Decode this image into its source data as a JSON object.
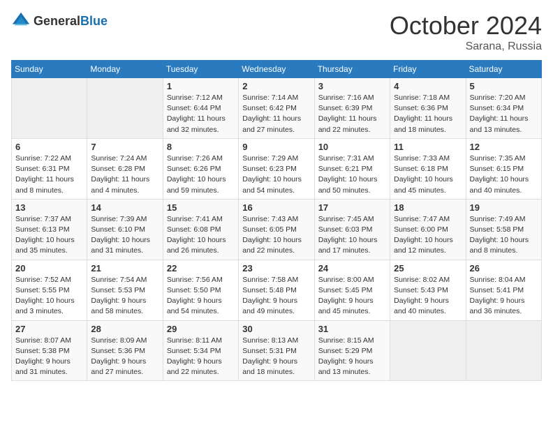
{
  "header": {
    "logo_general": "General",
    "logo_blue": "Blue",
    "month": "October 2024",
    "location": "Sarana, Russia"
  },
  "days_of_week": [
    "Sunday",
    "Monday",
    "Tuesday",
    "Wednesday",
    "Thursday",
    "Friday",
    "Saturday"
  ],
  "weeks": [
    [
      null,
      null,
      {
        "day": "1",
        "sunrise": "Sunrise: 7:12 AM",
        "sunset": "Sunset: 6:44 PM",
        "daylight": "Daylight: 11 hours and 32 minutes."
      },
      {
        "day": "2",
        "sunrise": "Sunrise: 7:14 AM",
        "sunset": "Sunset: 6:42 PM",
        "daylight": "Daylight: 11 hours and 27 minutes."
      },
      {
        "day": "3",
        "sunrise": "Sunrise: 7:16 AM",
        "sunset": "Sunset: 6:39 PM",
        "daylight": "Daylight: 11 hours and 22 minutes."
      },
      {
        "day": "4",
        "sunrise": "Sunrise: 7:18 AM",
        "sunset": "Sunset: 6:36 PM",
        "daylight": "Daylight: 11 hours and 18 minutes."
      },
      {
        "day": "5",
        "sunrise": "Sunrise: 7:20 AM",
        "sunset": "Sunset: 6:34 PM",
        "daylight": "Daylight: 11 hours and 13 minutes."
      }
    ],
    [
      {
        "day": "6",
        "sunrise": "Sunrise: 7:22 AM",
        "sunset": "Sunset: 6:31 PM",
        "daylight": "Daylight: 11 hours and 8 minutes."
      },
      {
        "day": "7",
        "sunrise": "Sunrise: 7:24 AM",
        "sunset": "Sunset: 6:28 PM",
        "daylight": "Daylight: 11 hours and 4 minutes."
      },
      {
        "day": "8",
        "sunrise": "Sunrise: 7:26 AM",
        "sunset": "Sunset: 6:26 PM",
        "daylight": "Daylight: 10 hours and 59 minutes."
      },
      {
        "day": "9",
        "sunrise": "Sunrise: 7:29 AM",
        "sunset": "Sunset: 6:23 PM",
        "daylight": "Daylight: 10 hours and 54 minutes."
      },
      {
        "day": "10",
        "sunrise": "Sunrise: 7:31 AM",
        "sunset": "Sunset: 6:21 PM",
        "daylight": "Daylight: 10 hours and 50 minutes."
      },
      {
        "day": "11",
        "sunrise": "Sunrise: 7:33 AM",
        "sunset": "Sunset: 6:18 PM",
        "daylight": "Daylight: 10 hours and 45 minutes."
      },
      {
        "day": "12",
        "sunrise": "Sunrise: 7:35 AM",
        "sunset": "Sunset: 6:15 PM",
        "daylight": "Daylight: 10 hours and 40 minutes."
      }
    ],
    [
      {
        "day": "13",
        "sunrise": "Sunrise: 7:37 AM",
        "sunset": "Sunset: 6:13 PM",
        "daylight": "Daylight: 10 hours and 35 minutes."
      },
      {
        "day": "14",
        "sunrise": "Sunrise: 7:39 AM",
        "sunset": "Sunset: 6:10 PM",
        "daylight": "Daylight: 10 hours and 31 minutes."
      },
      {
        "day": "15",
        "sunrise": "Sunrise: 7:41 AM",
        "sunset": "Sunset: 6:08 PM",
        "daylight": "Daylight: 10 hours and 26 minutes."
      },
      {
        "day": "16",
        "sunrise": "Sunrise: 7:43 AM",
        "sunset": "Sunset: 6:05 PM",
        "daylight": "Daylight: 10 hours and 22 minutes."
      },
      {
        "day": "17",
        "sunrise": "Sunrise: 7:45 AM",
        "sunset": "Sunset: 6:03 PM",
        "daylight": "Daylight: 10 hours and 17 minutes."
      },
      {
        "day": "18",
        "sunrise": "Sunrise: 7:47 AM",
        "sunset": "Sunset: 6:00 PM",
        "daylight": "Daylight: 10 hours and 12 minutes."
      },
      {
        "day": "19",
        "sunrise": "Sunrise: 7:49 AM",
        "sunset": "Sunset: 5:58 PM",
        "daylight": "Daylight: 10 hours and 8 minutes."
      }
    ],
    [
      {
        "day": "20",
        "sunrise": "Sunrise: 7:52 AM",
        "sunset": "Sunset: 5:55 PM",
        "daylight": "Daylight: 10 hours and 3 minutes."
      },
      {
        "day": "21",
        "sunrise": "Sunrise: 7:54 AM",
        "sunset": "Sunset: 5:53 PM",
        "daylight": "Daylight: 9 hours and 58 minutes."
      },
      {
        "day": "22",
        "sunrise": "Sunrise: 7:56 AM",
        "sunset": "Sunset: 5:50 PM",
        "daylight": "Daylight: 9 hours and 54 minutes."
      },
      {
        "day": "23",
        "sunrise": "Sunrise: 7:58 AM",
        "sunset": "Sunset: 5:48 PM",
        "daylight": "Daylight: 9 hours and 49 minutes."
      },
      {
        "day": "24",
        "sunrise": "Sunrise: 8:00 AM",
        "sunset": "Sunset: 5:45 PM",
        "daylight": "Daylight: 9 hours and 45 minutes."
      },
      {
        "day": "25",
        "sunrise": "Sunrise: 8:02 AM",
        "sunset": "Sunset: 5:43 PM",
        "daylight": "Daylight: 9 hours and 40 minutes."
      },
      {
        "day": "26",
        "sunrise": "Sunrise: 8:04 AM",
        "sunset": "Sunset: 5:41 PM",
        "daylight": "Daylight: 9 hours and 36 minutes."
      }
    ],
    [
      {
        "day": "27",
        "sunrise": "Sunrise: 8:07 AM",
        "sunset": "Sunset: 5:38 PM",
        "daylight": "Daylight: 9 hours and 31 minutes."
      },
      {
        "day": "28",
        "sunrise": "Sunrise: 8:09 AM",
        "sunset": "Sunset: 5:36 PM",
        "daylight": "Daylight: 9 hours and 27 minutes."
      },
      {
        "day": "29",
        "sunrise": "Sunrise: 8:11 AM",
        "sunset": "Sunset: 5:34 PM",
        "daylight": "Daylight: 9 hours and 22 minutes."
      },
      {
        "day": "30",
        "sunrise": "Sunrise: 8:13 AM",
        "sunset": "Sunset: 5:31 PM",
        "daylight": "Daylight: 9 hours and 18 minutes."
      },
      {
        "day": "31",
        "sunrise": "Sunrise: 8:15 AM",
        "sunset": "Sunset: 5:29 PM",
        "daylight": "Daylight: 9 hours and 13 minutes."
      },
      null,
      null
    ]
  ]
}
